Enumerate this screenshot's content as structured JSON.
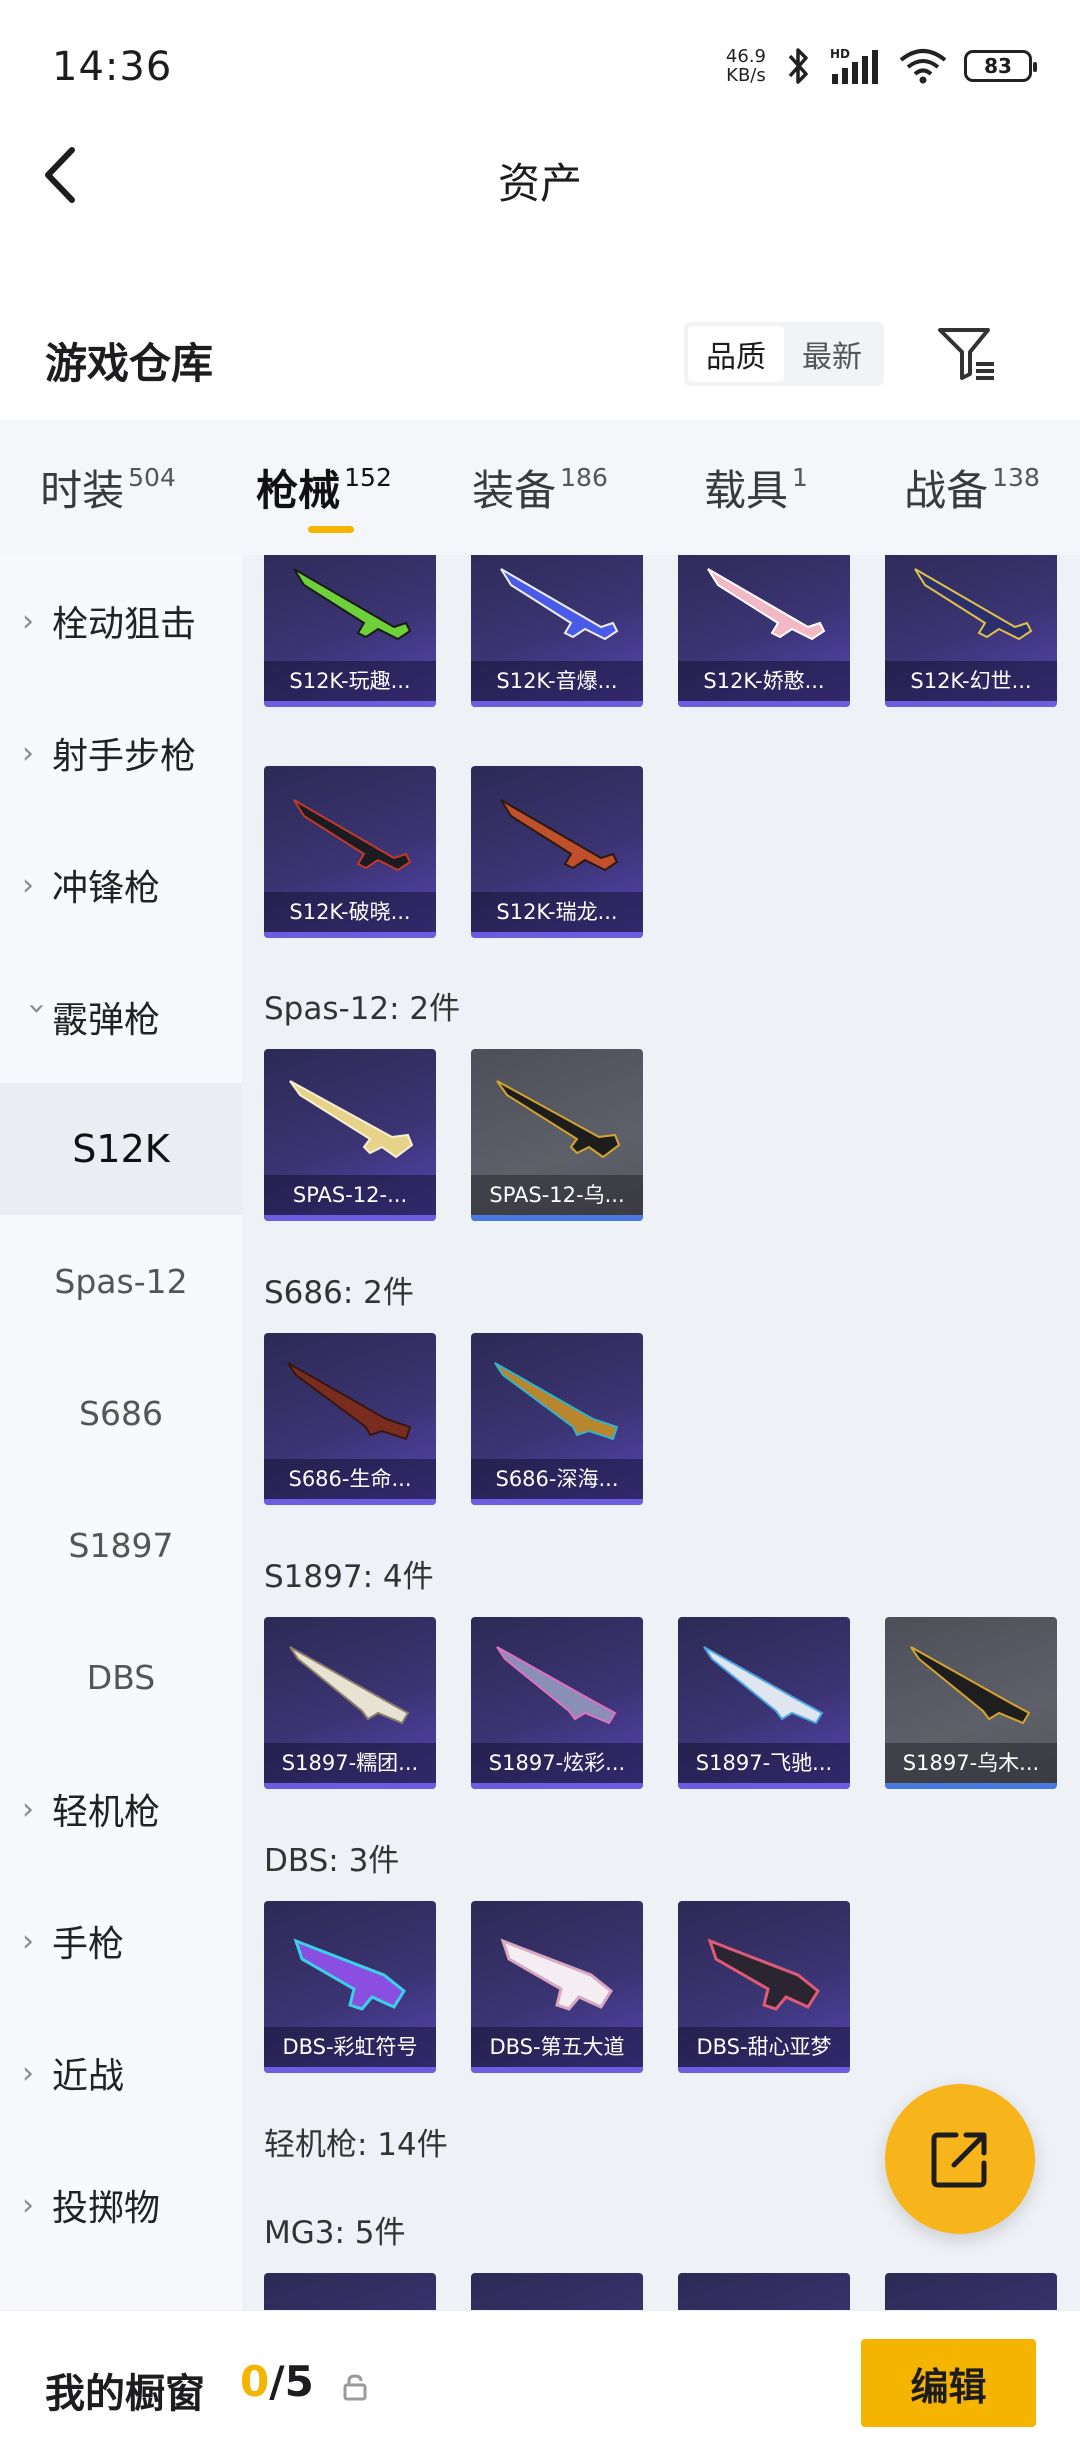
{
  "status": {
    "time": "14:36",
    "speed_value": "46.9",
    "speed_unit": "KB/s",
    "battery": "83"
  },
  "header": {
    "title": "资产"
  },
  "section": {
    "title": "游戏仓库",
    "sort_quality": "品质",
    "sort_latest": "最新"
  },
  "tabs": [
    {
      "label": "时装",
      "count": "504"
    },
    {
      "label": "枪械",
      "count": "152"
    },
    {
      "label": "装备",
      "count": "186"
    },
    {
      "label": "载具",
      "count": "1"
    },
    {
      "label": "战备",
      "count": "138"
    }
  ],
  "sidebar": {
    "items": [
      "栓动狙击",
      "射手步枪",
      "冲锋枪",
      "霰弹枪"
    ],
    "subs": [
      "S12K",
      "Spas-12",
      "S686",
      "S1897",
      "DBS"
    ],
    "items_after": [
      "轻机枪",
      "手枪",
      "近战",
      "投掷物"
    ]
  },
  "groups": {
    "spas": "Spas-12: 2件",
    "s686": "S686: 2件",
    "s1897": "S1897: 4件",
    "dbs": "DBS: 3件",
    "lmg": "轻机枪: 14件",
    "mg3": "MG3: 5件"
  },
  "cards": {
    "s12k": [
      "S12K-玩趣...",
      "S12K-音爆...",
      "S12K-娇憨...",
      "S12K-幻世..."
    ],
    "s12k_2": [
      "S12K-破晓...",
      "S12K-瑞龙..."
    ],
    "spas": [
      "SPAS-12-...",
      "SPAS-12-乌..."
    ],
    "s686": [
      "S686-生命...",
      "S686-深海..."
    ],
    "s1897": [
      "S1897-糯团...",
      "S1897-炫彩...",
      "S1897-飞驰...",
      "S1897-乌木..."
    ],
    "dbs": [
      "DBS-彩虹符号",
      "DBS-第五大道",
      "DBS-甜心亚梦"
    ]
  },
  "showcase": {
    "title": "我的橱窗",
    "current": "0",
    "total": "/5",
    "edit": "编辑"
  },
  "colors": {
    "accent": "#f5b400",
    "card_purple": "#3b3473",
    "card_gray": "#5e6069"
  }
}
